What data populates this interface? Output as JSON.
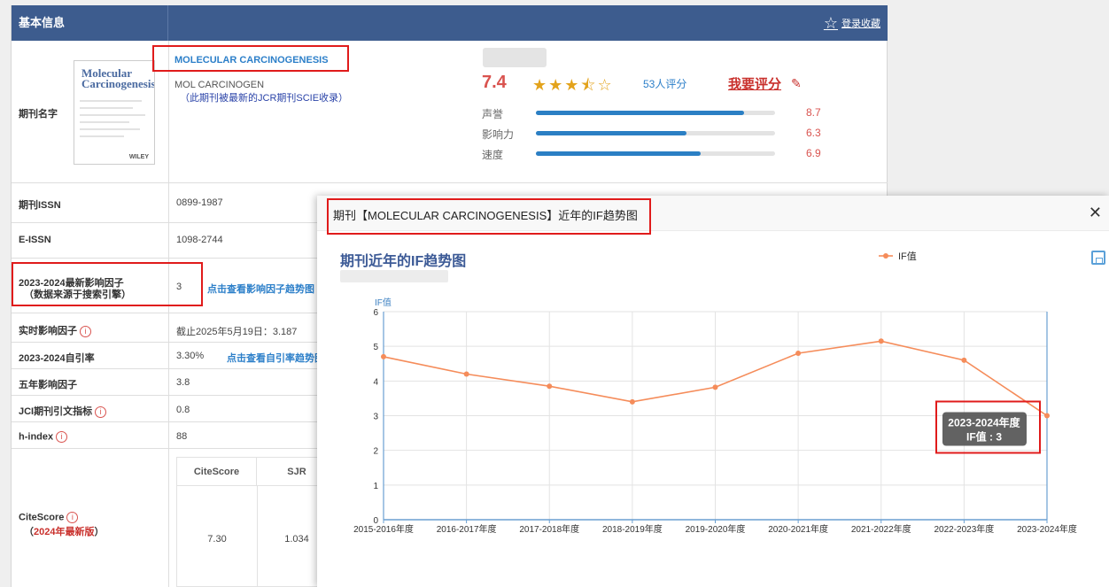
{
  "info": {
    "header_left": "基本信息",
    "favorite_label": "登录收藏",
    "journal_label": "期刊名字",
    "journal_name": "MOLECULAR CARCINOGENESIS",
    "journal_abbr": "MOL CARCINOGEN",
    "journal_note": "（此期刊被最新的JCR期刊SCIE收录）",
    "cover_title": [
      "Molecular",
      "Carcinogenesis"
    ],
    "cover_publisher": "WILEY",
    "score": "7.4",
    "stars": "★★★",
    "half_star": "⯪",
    "empty_star": "☆",
    "rating_count": "53人评分",
    "rate_me": "我要评分",
    "pencil_icon": "✎",
    "metrics": [
      {
        "label": "声誉",
        "value": "8.7",
        "fill": 0.87
      },
      {
        "label": "影响力",
        "value": "6.3",
        "fill": 0.63
      },
      {
        "label": "速度",
        "value": "6.9",
        "fill": 0.69
      }
    ],
    "rows": [
      {
        "label": "期刊ISSN",
        "value": "0899-1987"
      },
      {
        "label": "E-ISSN",
        "value": "1098-2744"
      },
      {
        "label": "2023-2024最新影响因子",
        "label2": "（数据来源于搜索引擎）",
        "value": "3",
        "link": "点击查看影响因子趋势图"
      },
      {
        "label": "实时影响因子",
        "value": "截止2025年5月19日：3.187"
      },
      {
        "label": "2023-2024自引率",
        "value": "3.30%",
        "link": "点击查看自引率趋势图"
      },
      {
        "label": "五年影响因子",
        "value": "3.8"
      },
      {
        "label": "JCI期刊引文指标",
        "value": "0.8"
      },
      {
        "label": "h-index",
        "value": "88"
      }
    ],
    "citescore_label": "CiteScore",
    "citescore_note_prefix": "（",
    "citescore_note": "2024年最新版",
    "citescore_note_suffix": "）",
    "info_glyph": "i",
    "table_headers": [
      "CiteScore",
      "SJR"
    ],
    "table_values": [
      "7.30",
      "1.034"
    ]
  },
  "modal": {
    "title": "期刊【MOLECULAR CARCINOGENESIS】近年的IF趋势图",
    "close_icon": "✕",
    "chart_title": "期刊近年的IF趋势图",
    "save_icon": "save-icon"
  },
  "chart_data": {
    "type": "line",
    "title": "期刊近年的IF趋势图",
    "ylabel": "IF值",
    "xlabel": "",
    "ylim": [
      0,
      6
    ],
    "yticks": [
      0,
      1,
      2,
      3,
      4,
      5,
      6
    ],
    "grid": true,
    "legend": "top-center",
    "categories": [
      "2015-2016年度",
      "2016-2017年度",
      "2017-2018年度",
      "2018-2019年度",
      "2019-2020年度",
      "2020-2021年度",
      "2021-2022年度",
      "2022-2023年度",
      "2023-2024年度"
    ],
    "series": [
      {
        "name": "IF值",
        "color": "#f58c5a",
        "values": [
          4.7,
          4.2,
          3.85,
          3.4,
          3.82,
          4.8,
          5.15,
          4.6,
          3.0
        ]
      }
    ],
    "tooltip": {
      "category": "2023-2024年度",
      "label": "IF值 : 3"
    }
  }
}
